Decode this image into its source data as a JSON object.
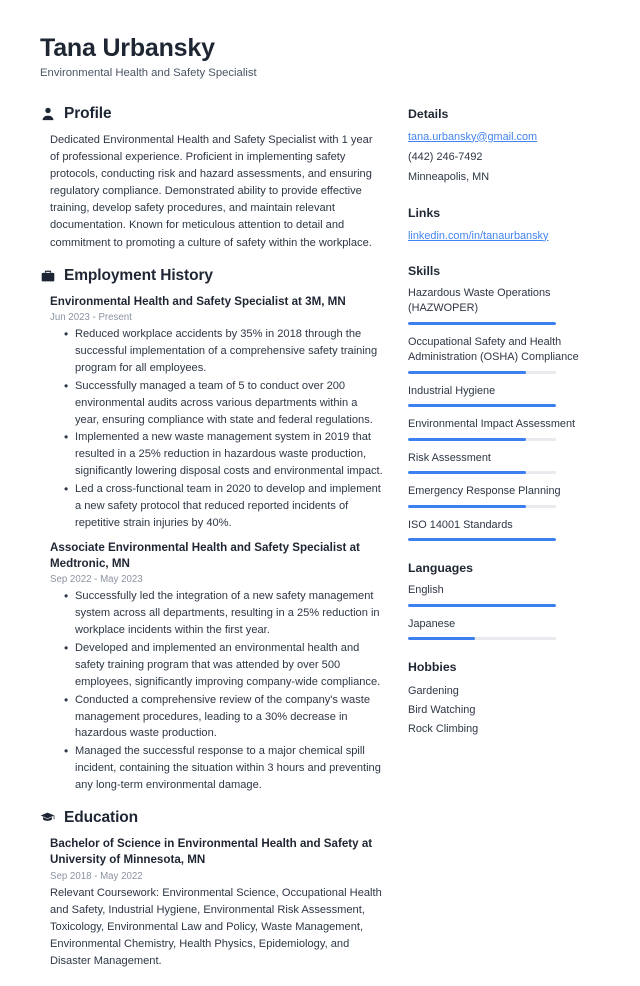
{
  "accent_color": "#3b7ff1",
  "link_color": "#4384f0",
  "heading_color": "#1f2633",
  "header": {
    "name": "Tana Urbansky",
    "title": "Environmental Health and Safety Specialist"
  },
  "sections": {
    "profile": {
      "icon": "person-icon",
      "title": "Profile",
      "text": "Dedicated Environmental Health and Safety Specialist with 1 year of professional experience. Proficient in implementing safety protocols, conducting risk and hazard assessments, and ensuring regulatory compliance. Demonstrated ability to provide effective training, develop safety procedures, and maintain relevant documentation. Known for meticulous attention to detail and commitment to promoting a culture of safety within the workplace."
    },
    "employment": {
      "icon": "briefcase-icon",
      "title": "Employment History",
      "entries": [
        {
          "title": "Environmental Health and Safety Specialist at 3M, MN",
          "date": "Jun 2023 - Present",
          "bullets": [
            "Reduced workplace accidents by 35% in 2018 through the successful implementation of a comprehensive safety training program for all employees.",
            "Successfully managed a team of 5 to conduct over 200 environmental audits across various departments within a year, ensuring compliance with state and federal regulations.",
            "Implemented a new waste management system in 2019 that resulted in a 25% reduction in hazardous waste production, significantly lowering disposal costs and environmental impact.",
            "Led a cross-functional team in 2020 to develop and implement a new safety protocol that reduced reported incidents of repetitive strain injuries by 40%."
          ]
        },
        {
          "title": "Associate Environmental Health and Safety Specialist at Medtronic, MN",
          "date": "Sep 2022 - May 2023",
          "bullets": [
            "Successfully led the integration of a new safety management system across all departments, resulting in a 25% reduction in workplace incidents within the first year.",
            "Developed and implemented an environmental health and safety training program that was attended by over 500 employees, significantly improving company-wide compliance.",
            "Conducted a comprehensive review of the company's waste management procedures, leading to a 30% decrease in hazardous waste production.",
            "Managed the successful response to a major chemical spill incident, containing the situation within 3 hours and preventing any long-term environmental damage."
          ]
        }
      ]
    },
    "education": {
      "icon": "graduation-cap-icon",
      "title": "Education",
      "entries": [
        {
          "title": "Bachelor of Science in Environmental Health and Safety at University of Minnesota, MN",
          "date": "Sep 2018 - May 2022",
          "description": "Relevant Coursework: Environmental Science, Occupational Health and Safety, Industrial Hygiene, Environmental Risk Assessment, Toxicology, Environmental Law and Policy, Waste Management, Environmental Chemistry, Health Physics, Epidemiology, and Disaster Management."
        }
      ]
    }
  },
  "sidebar": {
    "details": {
      "title": "Details",
      "email": "tana.urbansky@gmail.com",
      "phone": "(442) 246-7492",
      "location": "Minneapolis, MN"
    },
    "links": {
      "title": "Links",
      "items": [
        {
          "label": "linkedin.com/in/tanaurbansky"
        }
      ]
    },
    "skills": {
      "title": "Skills",
      "items": [
        {
          "label": "Hazardous Waste Operations (HAZWOPER)",
          "level": 100
        },
        {
          "label": "Occupational Safety and Health Administration (OSHA) Compliance",
          "level": 80
        },
        {
          "label": "Industrial Hygiene",
          "level": 100
        },
        {
          "label": "Environmental Impact Assessment",
          "level": 80
        },
        {
          "label": "Risk Assessment",
          "level": 80
        },
        {
          "label": "Emergency Response Planning",
          "level": 80
        },
        {
          "label": "ISO 14001 Standards",
          "level": 100
        }
      ]
    },
    "languages": {
      "title": "Languages",
      "items": [
        {
          "label": "English",
          "level": 100
        },
        {
          "label": "Japanese",
          "level": 45
        }
      ]
    },
    "hobbies": {
      "title": "Hobbies",
      "items": [
        {
          "label": "Gardening"
        },
        {
          "label": "Bird Watching"
        },
        {
          "label": "Rock Climbing"
        }
      ]
    }
  }
}
